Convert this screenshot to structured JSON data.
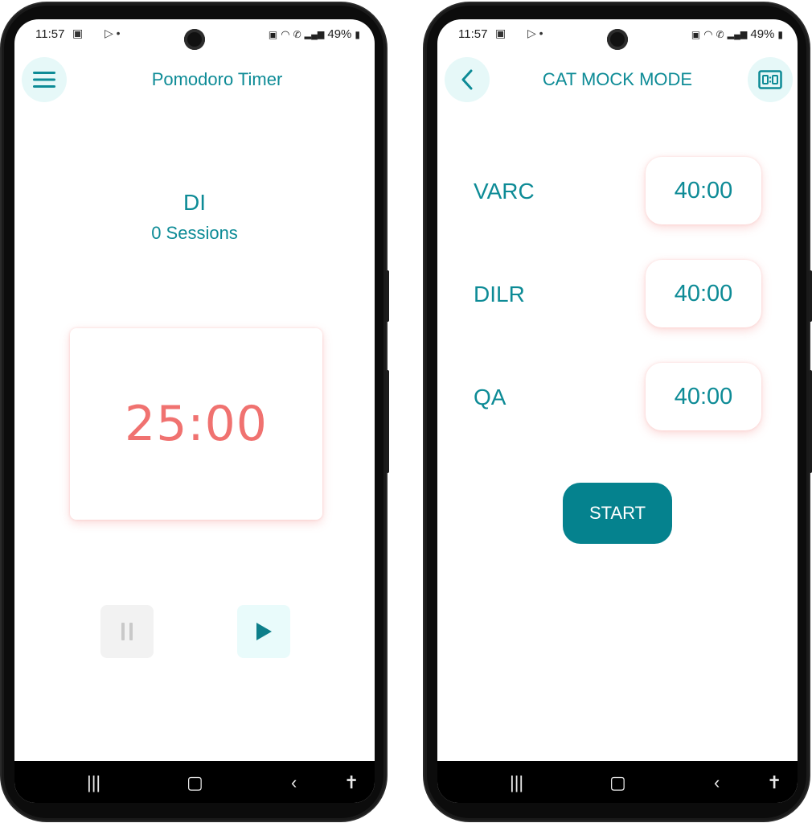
{
  "status_bar": {
    "time": "11:57",
    "battery": "49%"
  },
  "left_screen": {
    "title": "Pomodoro Timer",
    "menu_icon": "hamburger-menu-icon",
    "session_name": "DI",
    "session_count": "0 Sessions",
    "timer": "25:00",
    "pause_icon": "pause-icon",
    "play_icon": "play-icon"
  },
  "right_screen": {
    "title": "CAT MOCK MODE",
    "back_icon": "chevron-left-icon",
    "scoreboard_icon": "scoreboard-icon",
    "sections": [
      {
        "label": "VARC",
        "time": "40:00"
      },
      {
        "label": "DILR",
        "time": "40:00"
      },
      {
        "label": "QA",
        "time": "40:00"
      }
    ],
    "start_label": "START"
  },
  "nav_bar": {
    "icons": [
      "recent-apps-icon",
      "home-icon",
      "back-icon",
      "accessibility-icon"
    ]
  },
  "colors": {
    "accent": "#0d8b96",
    "timer_red": "#f07270",
    "start_button": "#05828e",
    "icon_bg": "#e6f8f8"
  }
}
